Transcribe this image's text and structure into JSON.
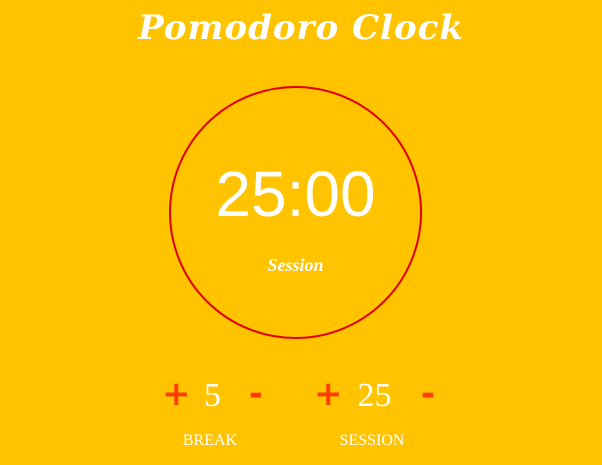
{
  "app": {
    "title": "Pomodoro Clock",
    "background_color": "#FFC300",
    "accent_color": "#FF3D00",
    "ring_color": "#E00000"
  },
  "clock": {
    "time": "25:00",
    "mode_label": "Session"
  },
  "break": {
    "plus_label": "+",
    "value": "5",
    "minus_label": "-",
    "label": "BREAK"
  },
  "session": {
    "plus_label": "+",
    "value": "25",
    "minus_label": "-",
    "label": "SESSION"
  }
}
